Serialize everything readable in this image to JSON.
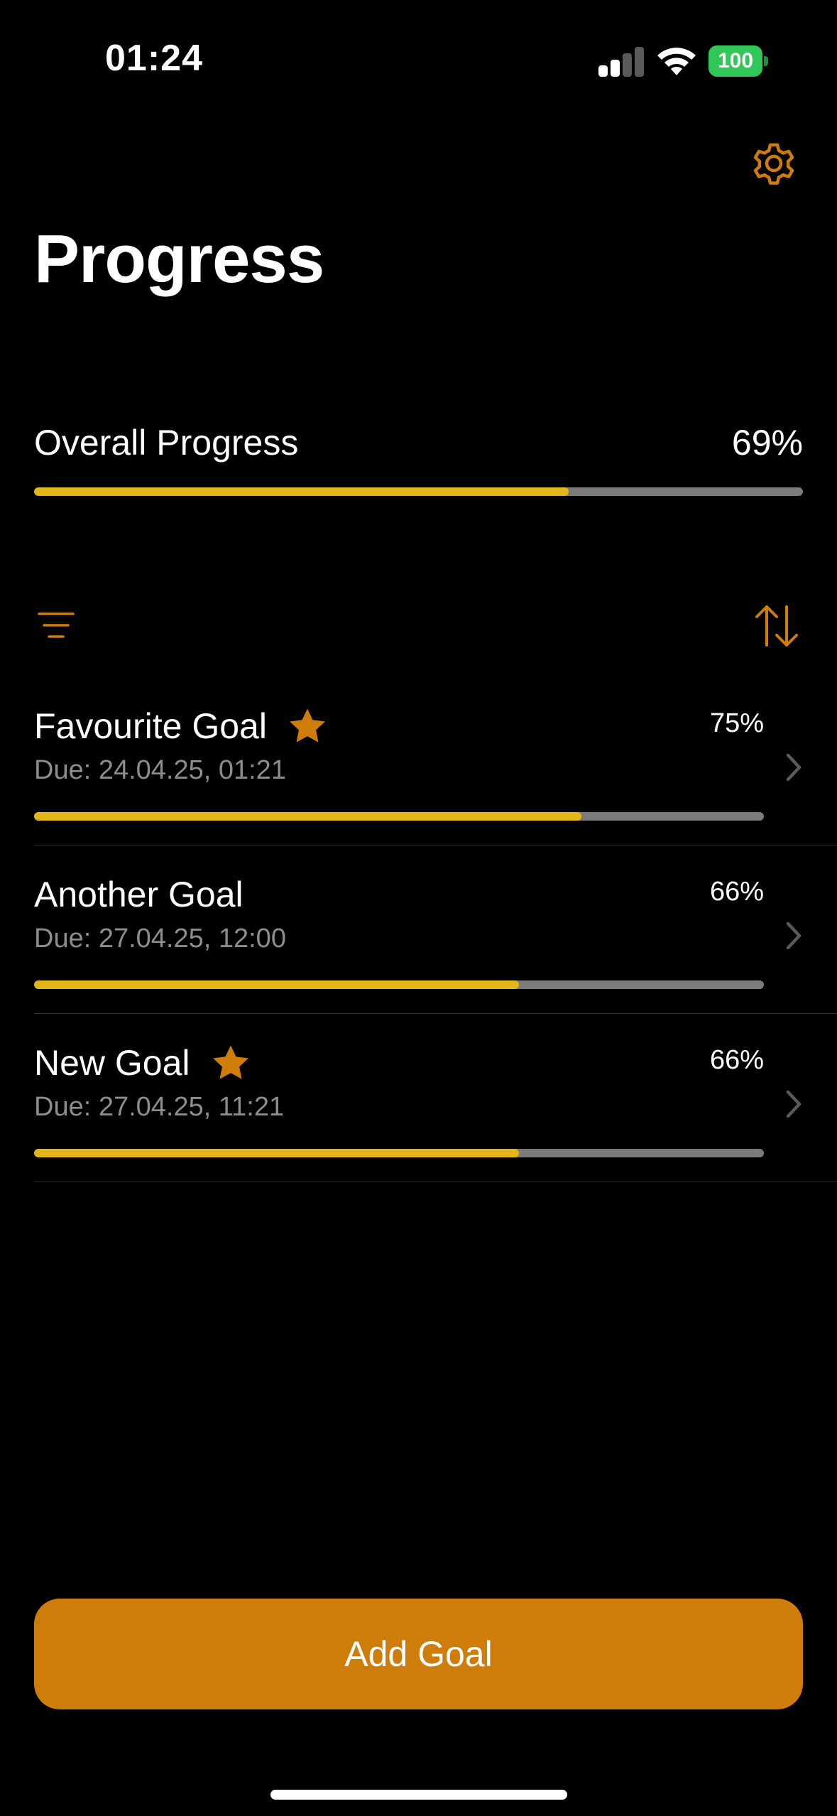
{
  "status_bar": {
    "time": "01:24",
    "battery": "100"
  },
  "header": {
    "title": "Progress",
    "settings_icon": "gear-icon"
  },
  "overall": {
    "label": "Overall Progress",
    "percent_text": "69%",
    "progress": 0.695
  },
  "toolbar": {
    "filter_icon": "filter-lines-icon",
    "sort_icon": "sort-arrows-icon"
  },
  "goals": [
    {
      "name": "Favourite Goal",
      "favourite": true,
      "due": "Due: 24.04.25, 01:21",
      "percent_text": "75%",
      "progress": 0.75
    },
    {
      "name": "Another Goal",
      "favourite": false,
      "due": "Due: 27.04.25, 12:00",
      "percent_text": "66%",
      "progress": 0.664
    },
    {
      "name": "New Goal",
      "favourite": true,
      "due": "Due: 27.04.25, 11:21",
      "percent_text": "66%",
      "progress": 0.664
    }
  ],
  "add_button": {
    "label": "Add Goal"
  },
  "colors": {
    "accent": "#ce7d0a",
    "progress_fill": "#e2b619",
    "progress_track": "#7b7b7b",
    "battery": "#30c758",
    "background": "#000000"
  }
}
